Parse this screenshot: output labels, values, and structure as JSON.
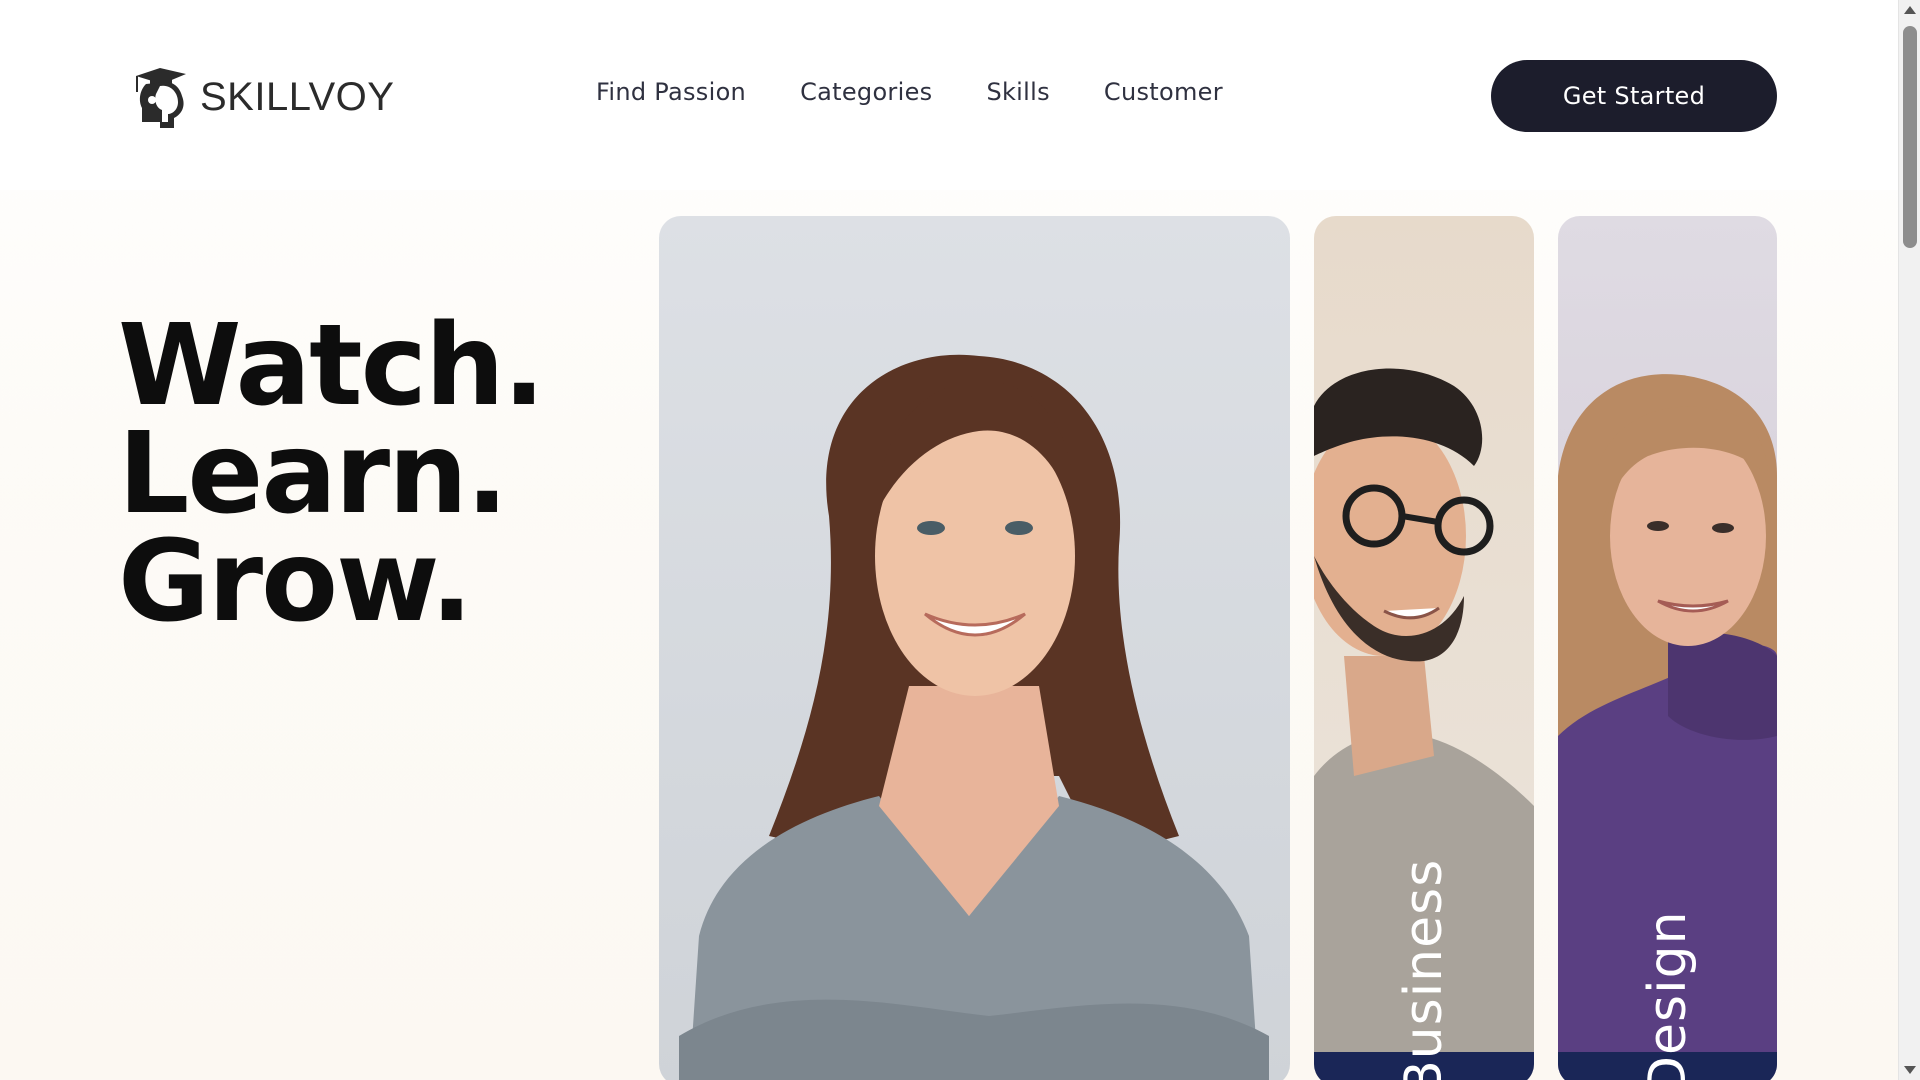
{
  "brand": {
    "name": "SKILLVOY",
    "logo_icon": "graduate-head-icon"
  },
  "nav": {
    "items": [
      {
        "label": "Find Passion"
      },
      {
        "label": "Categories"
      },
      {
        "label": "Skills"
      },
      {
        "label": "Customer"
      }
    ]
  },
  "cta": {
    "label": "Get Started"
  },
  "hero": {
    "lines": [
      "Watch.",
      "Learn.",
      "Grow."
    ]
  },
  "cards": [
    {
      "label": ""
    },
    {
      "label": "Business"
    },
    {
      "label": "Design"
    }
  ],
  "colors": {
    "cta_bg": "#1c1d2c",
    "card_band": "#1a2657",
    "text_dark": "#0d0d0d"
  }
}
